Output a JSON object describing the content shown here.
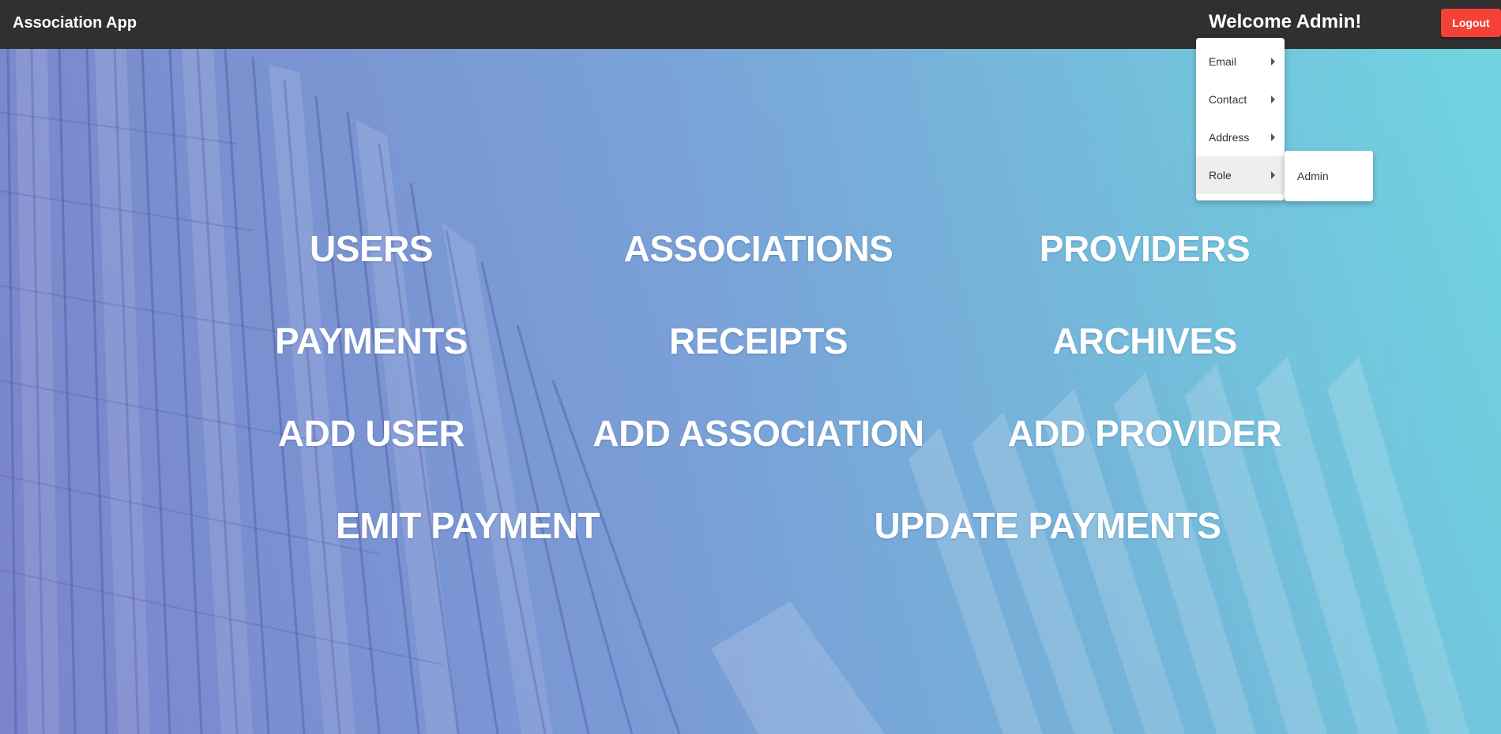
{
  "topbar": {
    "brand": "Association App",
    "welcome": "Welcome Admin!",
    "logout_label": "Logout"
  },
  "nav": {
    "users": "USERS",
    "associations": "ASSOCIATIONS",
    "providers": "PROVIDERS",
    "payments": "PAYMENTS",
    "receipts": "RECEIPTS",
    "archives": "ARCHIVES",
    "add_user": "ADD USER",
    "add_association": "ADD ASSOCIATION",
    "add_provider": "ADD PROVIDER",
    "emit_payment": "EMIT PAYMENT",
    "update_payments": "UPDATE PAYMENTS"
  },
  "profile_menu": {
    "items": [
      {
        "label": "Email"
      },
      {
        "label": "Contact"
      },
      {
        "label": "Address"
      },
      {
        "label": "Role"
      }
    ],
    "role_submenu": {
      "label": "Admin"
    }
  },
  "colors": {
    "topbar": "#303030",
    "logout": "#f44336",
    "hero_left": "#7a89cc",
    "hero_right": "#70d5e0"
  },
  "icons": {
    "submenu_caret": "caret-right-icon"
  }
}
